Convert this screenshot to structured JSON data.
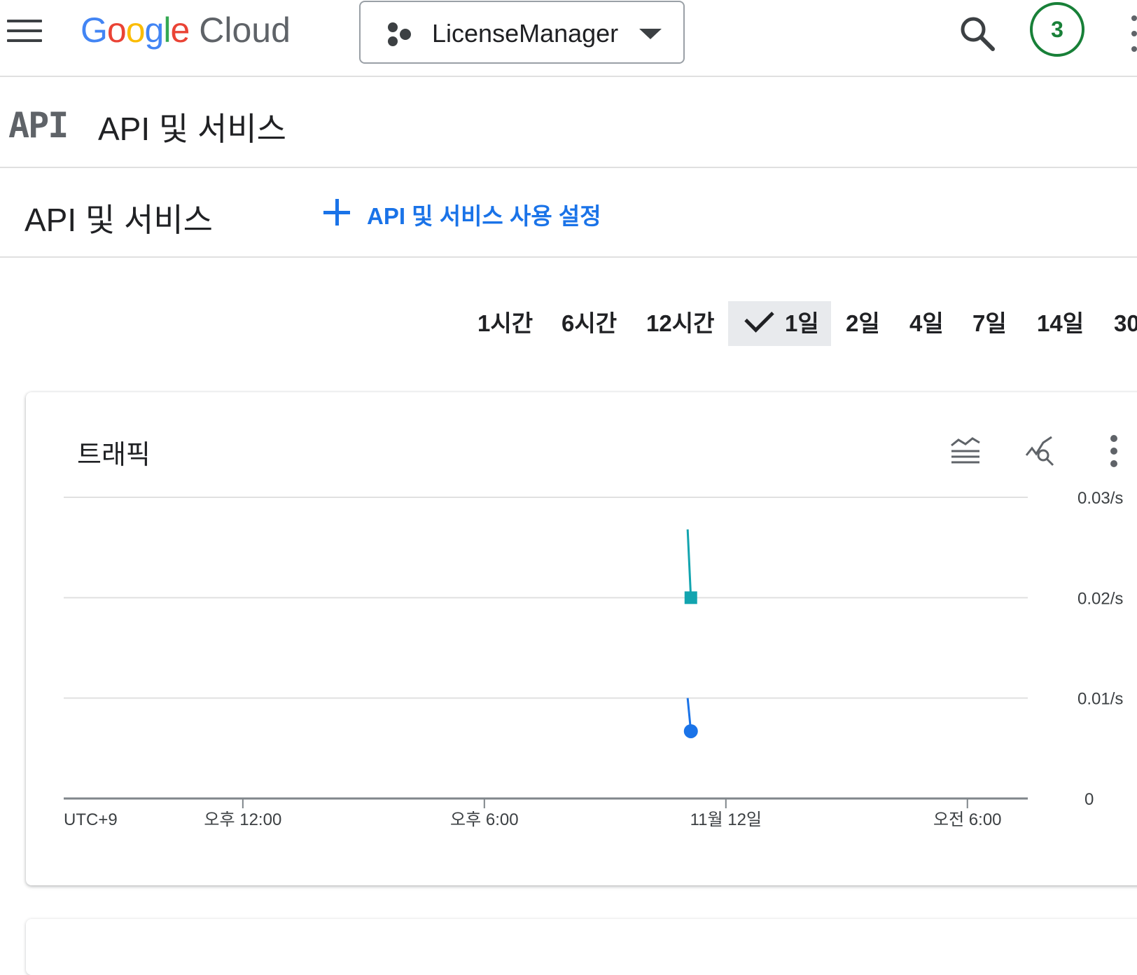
{
  "topbar": {
    "logo_google_letters": [
      "G",
      "o",
      "o",
      "g",
      "l",
      "e"
    ],
    "logo_google_colors": [
      "#4285f4",
      "#ea4335",
      "#fbbc04",
      "#4285f4",
      "#34a853",
      "#ea4335"
    ],
    "logo_cloud": "Cloud",
    "project_name": "LicenseManager",
    "notification_count": "3",
    "icons": [
      "menu-icon",
      "search-icon",
      "kebab-icon"
    ]
  },
  "section": {
    "logo_text": "API",
    "title": "API 및 서비스"
  },
  "page": {
    "title": "API 및 서비스",
    "enable_button_label": "API 및 서비스 사용 설정"
  },
  "time_range": {
    "options": [
      "1시간",
      "6시간",
      "12시간",
      "1일",
      "2일",
      "4일",
      "7일",
      "14일",
      "30"
    ],
    "selected": "1일"
  },
  "colors": {
    "accent": "#1a73e8",
    "series_teal": "#12a4af",
    "series_blue": "#1a73e8",
    "badge_green": "#188038"
  },
  "traffic_card": {
    "title": "트래픽",
    "icons": [
      "legend-toggle-icon",
      "explore-chart-icon",
      "more-vert-icon"
    ]
  },
  "chart_data": {
    "type": "line",
    "title": "트래픽",
    "timezone_label": "UTC+9",
    "x_tick_labels": [
      "오후 12:00",
      "오후 6:00",
      "11월 12일",
      "오전 6:00"
    ],
    "x_tick_hours": [
      12,
      18,
      24,
      30
    ],
    "x_range_hours": [
      7.55,
      31.5
    ],
    "y_tick_labels": [
      "0",
      "0.01/s",
      "0.02/s",
      "0.03/s"
    ],
    "y_tick_values": [
      0,
      0.01,
      0.02,
      0.03
    ],
    "ylim": [
      0,
      0.03
    ],
    "grid": true,
    "series": [
      {
        "color": "#12a4af",
        "marker": "square",
        "points": [
          [
            23.05,
            0.0268
          ],
          [
            23.13,
            0.02
          ]
        ]
      },
      {
        "color": "#1a73e8",
        "marker": "circle",
        "points": [
          [
            23.05,
            0.01
          ],
          [
            23.13,
            0.0067
          ]
        ]
      }
    ]
  }
}
